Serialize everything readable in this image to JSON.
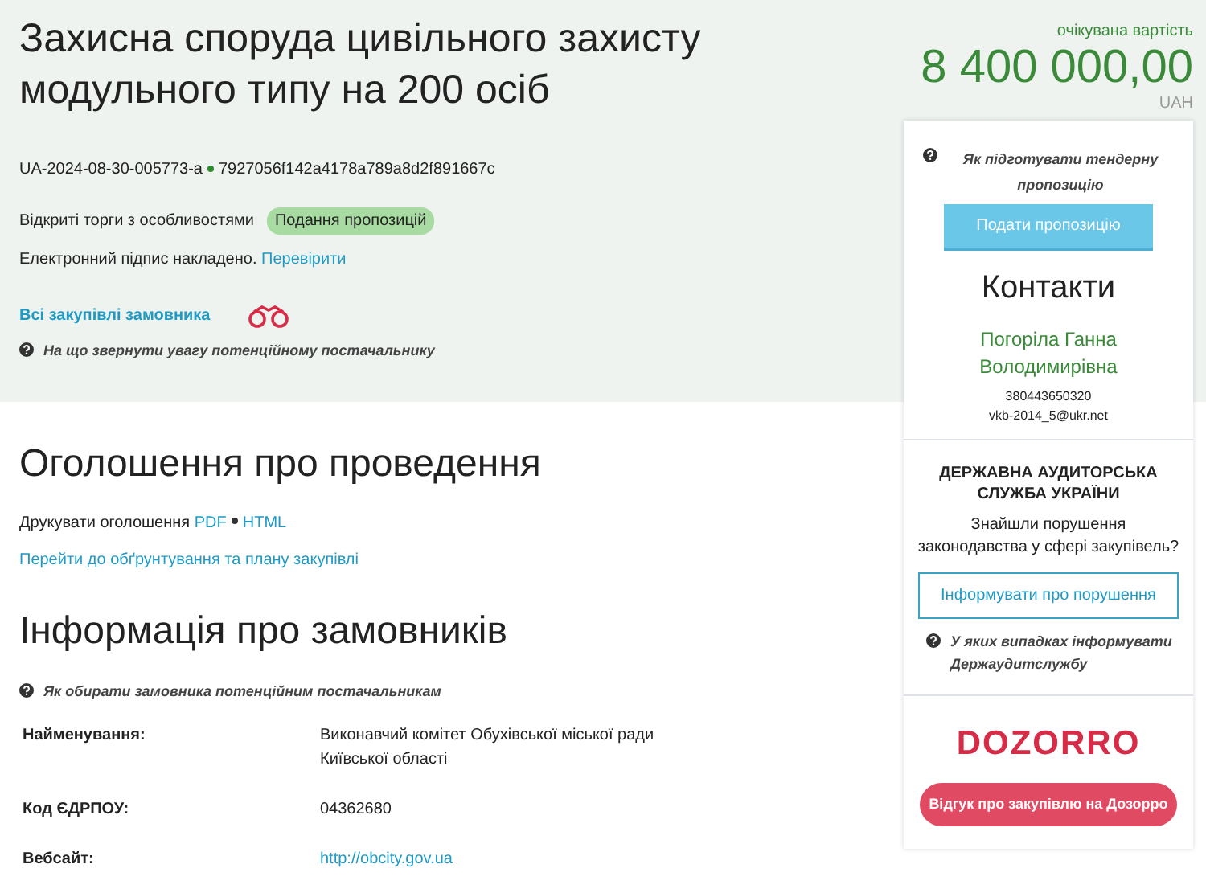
{
  "tender": {
    "title": "Захисна споруда цивільного захисту модульного типу на 200 осіб",
    "id": "UA-2024-08-30-005773-a",
    "hash": "7927056f142a4178a789a8d2f891667c",
    "procedure": "Відкриті торги з особливостями",
    "status": "Подання пропозицій",
    "signature_text": "Електронний підпис накладено.",
    "signature_link": "Перевірити",
    "buyer_link": "Всі закупівлі замовника",
    "hint": "На що звернути увагу потенційному постачальнику"
  },
  "price": {
    "label": "очікувана вартість",
    "amount": "8 400 000,00",
    "currency": "UAH"
  },
  "announcement": {
    "heading": "Оголошення про проведення",
    "print_label": "Друкувати оголошення",
    "print_links": [
      "PDF",
      "HTML"
    ],
    "plan_link": "Перейти до обґрунтування та плану закупівлі"
  },
  "buyers": {
    "heading": "Інформація про замовників",
    "hint": "Як обирати замовника потенційним постачальникам",
    "rows": [
      {
        "label": "Найменування:",
        "value": "Виконавчий комітет Обухівської міської ради Київської області",
        "kind": "text"
      },
      {
        "label": "Код ЄДРПОУ:",
        "value": "04362680",
        "kind": "text"
      },
      {
        "label": "Вебсайт:",
        "value": "http://obcity.gov.ua",
        "kind": "link"
      }
    ]
  },
  "sidebar": {
    "hint": "Як підготувати тендерну пропозицію",
    "submit_button": "Подати пропозицію",
    "contacts_heading": "Контакти",
    "contact_name": "Погоріла Ганна Володимирівна",
    "phone": "380443650320",
    "email": "vkb-2014_5@ukr.net",
    "audit_title": "ДЕРЖАВНА АУДИТОРСЬКА СЛУЖБА УКРАЇНИ",
    "audit_question": "Знайшли порушення законодавства у сфері закупівель?",
    "audit_button": "Інформувати про порушення",
    "audit_hint": "У яких випадках інформувати Держаудитслужбу",
    "dozorro_logo": "DOZORRO",
    "dozorro_button": "Відгук про закупівлю на Дозорро"
  }
}
